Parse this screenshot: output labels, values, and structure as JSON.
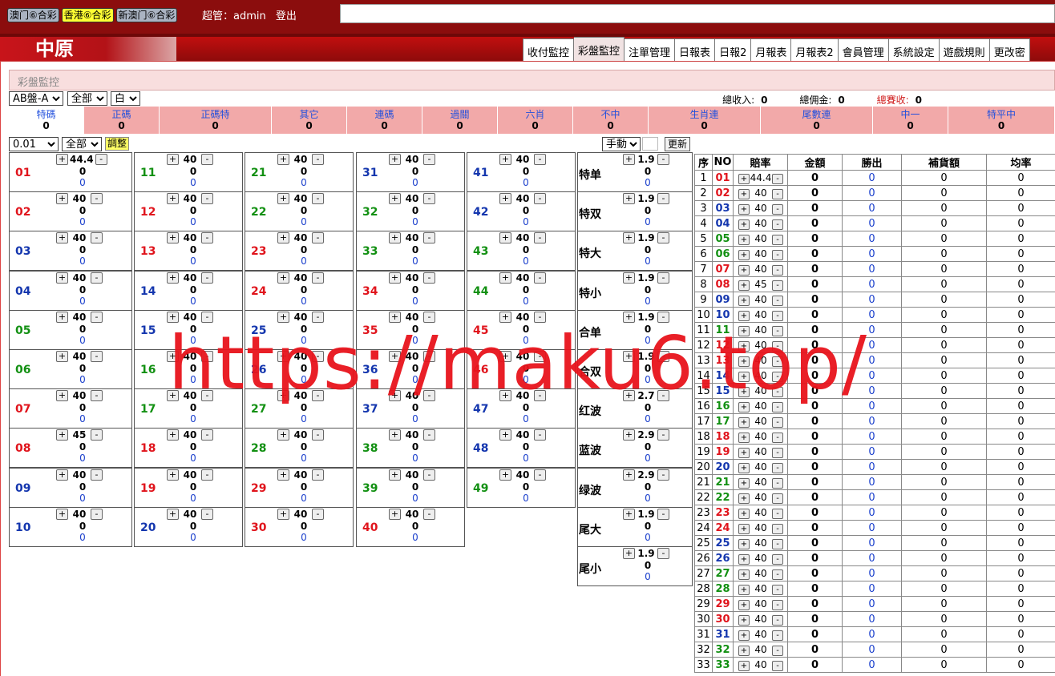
{
  "lottery_tabs": [
    "澳门⑥合彩",
    "香港⑥合彩",
    "新澳门⑥合彩"
  ],
  "active_lottery_index": 1,
  "user": {
    "role_label": "超管：admin",
    "logout": "登出"
  },
  "logo_text": "中原",
  "nav_tabs": [
    "收付監控",
    "彩盤監控",
    "注單管理",
    "日報表",
    "日報2",
    "月報表",
    "月報表2",
    "會員管理",
    "系統設定",
    "遊戲規則",
    "更改密"
  ],
  "active_nav_index": 1,
  "page_subtitle": "彩盤監控",
  "filters": {
    "pan": "AB盤-A",
    "scope": "全部",
    "mode": "白"
  },
  "totals": {
    "income_label": "總收入:",
    "income": "0",
    "commission_label": "總佣金:",
    "commission": "0",
    "gain_label": "總賽收:",
    "gain": "0"
  },
  "categories": [
    {
      "label": "特碼",
      "value": "0"
    },
    {
      "label": "正碼",
      "value": "0"
    },
    {
      "label": "正碼特",
      "value": "0"
    },
    {
      "label": "其它",
      "value": "0"
    },
    {
      "label": "連碼",
      "value": "0"
    },
    {
      "label": "過關",
      "value": "0"
    },
    {
      "label": "六肖",
      "value": "0"
    },
    {
      "label": "不中",
      "value": "0"
    },
    {
      "label": "生肖連",
      "value": "0"
    },
    {
      "label": "尾數連",
      "value": "0"
    },
    {
      "label": "中一",
      "value": "0"
    },
    {
      "label": "特平中",
      "value": "0"
    }
  ],
  "adjust": {
    "step": "0.01",
    "scope": "全部",
    "button": "調整",
    "manual": "手動",
    "refresh": "更新"
  },
  "numbers": [
    {
      "n": "01",
      "c": "r",
      "odds": "44.4"
    },
    {
      "n": "02",
      "c": "r",
      "odds": "40"
    },
    {
      "n": "03",
      "c": "b",
      "odds": "40"
    },
    {
      "n": "04",
      "c": "b",
      "odds": "40"
    },
    {
      "n": "05",
      "c": "g",
      "odds": "40"
    },
    {
      "n": "06",
      "c": "g",
      "odds": "40"
    },
    {
      "n": "07",
      "c": "r",
      "odds": "40"
    },
    {
      "n": "08",
      "c": "r",
      "odds": "45"
    },
    {
      "n": "09",
      "c": "b",
      "odds": "40"
    },
    {
      "n": "10",
      "c": "b",
      "odds": "40"
    },
    {
      "n": "11",
      "c": "g",
      "odds": "40"
    },
    {
      "n": "12",
      "c": "r",
      "odds": "40"
    },
    {
      "n": "13",
      "c": "r",
      "odds": "40"
    },
    {
      "n": "14",
      "c": "b",
      "odds": "40"
    },
    {
      "n": "15",
      "c": "b",
      "odds": "40"
    },
    {
      "n": "16",
      "c": "g",
      "odds": "40"
    },
    {
      "n": "17",
      "c": "g",
      "odds": "40"
    },
    {
      "n": "18",
      "c": "r",
      "odds": "40"
    },
    {
      "n": "19",
      "c": "r",
      "odds": "40"
    },
    {
      "n": "20",
      "c": "b",
      "odds": "40"
    },
    {
      "n": "21",
      "c": "g",
      "odds": "40"
    },
    {
      "n": "22",
      "c": "g",
      "odds": "40"
    },
    {
      "n": "23",
      "c": "r",
      "odds": "40"
    },
    {
      "n": "24",
      "c": "r",
      "odds": "40"
    },
    {
      "n": "25",
      "c": "b",
      "odds": "40"
    },
    {
      "n": "26",
      "c": "b",
      "odds": "40"
    },
    {
      "n": "27",
      "c": "g",
      "odds": "40"
    },
    {
      "n": "28",
      "c": "g",
      "odds": "40"
    },
    {
      "n": "29",
      "c": "r",
      "odds": "40"
    },
    {
      "n": "30",
      "c": "r",
      "odds": "40"
    },
    {
      "n": "31",
      "c": "b",
      "odds": "40"
    },
    {
      "n": "32",
      "c": "g",
      "odds": "40"
    },
    {
      "n": "33",
      "c": "g",
      "odds": "40"
    },
    {
      "n": "34",
      "c": "r",
      "odds": "40"
    },
    {
      "n": "35",
      "c": "r",
      "odds": "40"
    },
    {
      "n": "36",
      "c": "b",
      "odds": "40"
    },
    {
      "n": "37",
      "c": "b",
      "odds": "40"
    },
    {
      "n": "38",
      "c": "g",
      "odds": "40"
    },
    {
      "n": "39",
      "c": "g",
      "odds": "40"
    },
    {
      "n": "40",
      "c": "r",
      "odds": "40"
    },
    {
      "n": "41",
      "c": "b",
      "odds": "40"
    },
    {
      "n": "42",
      "c": "b",
      "odds": "40"
    },
    {
      "n": "43",
      "c": "g",
      "odds": "40"
    },
    {
      "n": "44",
      "c": "g",
      "odds": "40"
    },
    {
      "n": "45",
      "c": "r",
      "odds": "40"
    },
    {
      "n": "46",
      "c": "r",
      "odds": "40"
    },
    {
      "n": "47",
      "c": "b",
      "odds": "40"
    },
    {
      "n": "48",
      "c": "b",
      "odds": "40"
    },
    {
      "n": "49",
      "c": "g",
      "odds": "40"
    }
  ],
  "specials": [
    {
      "label": "特单",
      "odds": "1.9"
    },
    {
      "label": "特双",
      "odds": "1.9"
    },
    {
      "label": "特大",
      "odds": "1.9"
    },
    {
      "label": "特小",
      "odds": "1.9"
    },
    {
      "label": "合单",
      "odds": "1.9"
    },
    {
      "label": "合双",
      "odds": "1.9"
    },
    {
      "label": "红波",
      "odds": "2.7"
    },
    {
      "label": "蓝波",
      "odds": "2.9"
    },
    {
      "label": "绿波",
      "odds": "2.9"
    },
    {
      "label": "尾大",
      "odds": "1.9"
    },
    {
      "label": "尾小",
      "odds": "1.9"
    }
  ],
  "right_table": {
    "headers": [
      "序",
      "NO",
      "賠率",
      "金額",
      "勝出",
      "補貨額",
      "均率"
    ],
    "visible_rows": 33
  },
  "watermark": "https://maku6.top/",
  "colors": {
    "red": "#e0141c",
    "green": "#129012",
    "blue": "#1436ae",
    "header": "#8b0d0d",
    "category_bg": "#f2a9a9"
  }
}
